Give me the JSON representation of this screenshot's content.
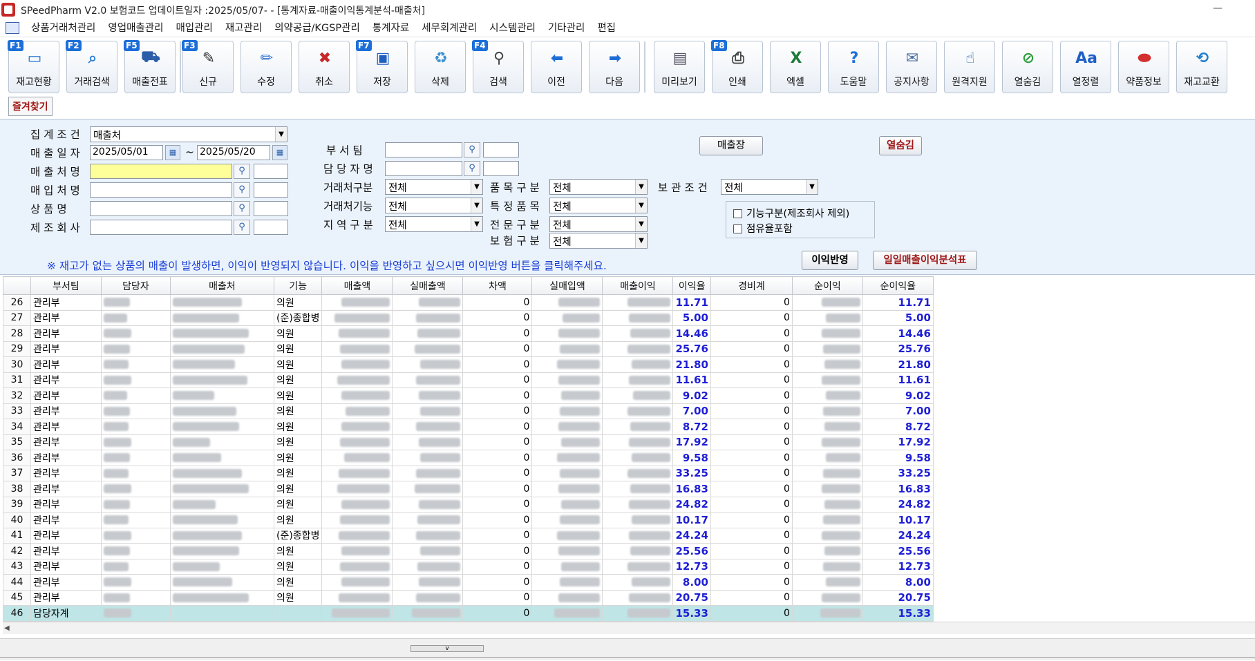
{
  "window": {
    "title": "SPeedPharm V2.0    보험코드 업데이트일자 :2025/05/07-          - [통계자료-매출이익통계분석-매출처]",
    "minimize_label": "—"
  },
  "menu": [
    "상품거래처관리",
    "영업매출관리",
    "매입관리",
    "재고관리",
    "의약공급/KGSP관리",
    "통계자료",
    "세무회계관리",
    "시스템관리",
    "기타관리",
    "편집"
  ],
  "toolbar": {
    "buttons": [
      {
        "label": "재고현황",
        "fkey": "F1",
        "icon": "monitor-icon",
        "glyph": "▭",
        "color": "#1b6fd0"
      },
      {
        "label": "거래검색",
        "fkey": "F2",
        "icon": "search-person-icon",
        "glyph": "⌕",
        "color": "#2f7fd6"
      },
      {
        "label": "매출전표",
        "fkey": "F5",
        "icon": "medicine-cart-icon",
        "glyph": "⛟",
        "color": "#2a5ea8"
      },
      {
        "label": "신규",
        "fkey": "F3",
        "icon": "new-document-icon",
        "glyph": "✎",
        "color": "#333"
      },
      {
        "label": "수정",
        "fkey": "",
        "icon": "pencil-icon",
        "glyph": "✏",
        "color": "#2f6fd0"
      },
      {
        "label": "취소",
        "fkey": "",
        "icon": "trash-cancel-icon",
        "glyph": "✖",
        "color": "#c62828"
      },
      {
        "label": "저장",
        "fkey": "F7",
        "icon": "save-icon",
        "glyph": "▣",
        "color": "#1e5fc0"
      },
      {
        "label": "삭제",
        "fkey": "",
        "icon": "recycle-icon",
        "glyph": "♻",
        "color": "#3a8fd0"
      },
      {
        "label": "검색",
        "fkey": "F4",
        "icon": "magnifier-icon",
        "glyph": "⚲",
        "color": "#444"
      },
      {
        "label": "이전",
        "fkey": "",
        "icon": "arrow-left-icon",
        "glyph": "⬅",
        "color": "#1f6fd6"
      },
      {
        "label": "다음",
        "fkey": "",
        "icon": "arrow-right-icon",
        "glyph": "➡",
        "color": "#1f6fd6"
      },
      {
        "label": "미리보기",
        "fkey": "",
        "icon": "preview-icon",
        "glyph": "▤",
        "color": "#556"
      },
      {
        "label": "인쇄",
        "fkey": "F8",
        "icon": "printer-icon",
        "glyph": "⎙",
        "color": "#444"
      },
      {
        "label": "엑셀",
        "fkey": "",
        "icon": "excel-icon",
        "glyph": "X",
        "color": "#1e7a3a"
      },
      {
        "label": "도움말",
        "fkey": "",
        "icon": "help-icon",
        "glyph": "?",
        "color": "#1e6fd8"
      },
      {
        "label": "공지사항",
        "fkey": "",
        "icon": "notice-icon",
        "glyph": "✉",
        "color": "#4a6fa5"
      },
      {
        "label": "원격지원",
        "fkey": "",
        "icon": "remote-support-icon",
        "glyph": "☝",
        "color": "#1a5fb8"
      },
      {
        "label": "열숨김",
        "fkey": "",
        "icon": "hide-column-icon",
        "glyph": "⊘",
        "color": "#2e9e3a"
      },
      {
        "label": "열정렬",
        "fkey": "",
        "icon": "font-sort-icon",
        "glyph": "Aa",
        "color": "#1f5fc8"
      },
      {
        "label": "약품정보",
        "fkey": "",
        "icon": "pill-icon",
        "glyph": "⬬",
        "color": "#d32f2f"
      },
      {
        "label": "재고교환",
        "fkey": "",
        "icon": "exchange-icon",
        "glyph": "⟲",
        "color": "#1f7fd0"
      }
    ]
  },
  "favorites_label": "즐겨찾기",
  "filters": {
    "aggregate_label": "집 계 조 건",
    "aggregate_value": "매출처",
    "sales_date_label": "매 출 일 자",
    "date_from": "2025/05/01",
    "date_tilde": "~",
    "date_to": "2025/05/20",
    "customer_label": "매 출 처 명",
    "supplier_label": "매 입 처 명",
    "product_label": "상   품   명",
    "maker_label": "제 조 회 사",
    "dept_label": "부   서   팀",
    "manager_label": "담 당 자 명",
    "client_type_label": "거래처구분",
    "client_type_value": "전체",
    "client_func_label": "거래처기능",
    "client_func_value": "전체",
    "region_label": "지 역 구 분",
    "region_value": "전체",
    "item_type_label": "품 목 구 분",
    "item_type_value": "전체",
    "special_item_label": "특 정 품 목",
    "special_item_value": "전체",
    "specialty_label": "전 문 구 분",
    "specialty_value": "전체",
    "insurance_label": "보 험 구 분",
    "insurance_value": "전체",
    "storage_label": "보 관 조 건",
    "storage_value": "전체",
    "check_function": "기능구분(제조회사 제외)",
    "check_share": "점유율포함",
    "ledger_button": "매출장",
    "hide_column_button": "열숨김",
    "profit_apply_button": "이익반영",
    "daily_analysis_button": "일일매출이익분석표",
    "notice": "※ 재고가 없는 상품의 매출이 발생하면, 이익이 반영되지 않습니다. 이익을 반영하고 싶으시면 이익반영 버튼을 클릭해주세요."
  },
  "table": {
    "columns": [
      "",
      "부서팀",
      "담당자",
      "매출처",
      "기능",
      "매출액",
      "실매출액",
      "차액",
      "실매입액",
      "매출이익",
      "이익율",
      "경비계",
      "순이익",
      "순이익율"
    ],
    "rows": [
      {
        "n": "26",
        "dept": "관리부",
        "func": "의원",
        "diff": "0",
        "rate": "11.71",
        "expense": "0",
        "net_rate": "11.71"
      },
      {
        "n": "27",
        "dept": "관리부",
        "func": "(준)종합병",
        "diff": "0",
        "rate": "5.00",
        "expense": "0",
        "net_rate": "5.00"
      },
      {
        "n": "28",
        "dept": "관리부",
        "func": "의원",
        "diff": "0",
        "rate": "14.46",
        "expense": "0",
        "net_rate": "14.46"
      },
      {
        "n": "29",
        "dept": "관리부",
        "func": "의원",
        "diff": "0",
        "rate": "25.76",
        "expense": "0",
        "net_rate": "25.76"
      },
      {
        "n": "30",
        "dept": "관리부",
        "func": "의원",
        "diff": "0",
        "rate": "21.80",
        "expense": "0",
        "net_rate": "21.80"
      },
      {
        "n": "31",
        "dept": "관리부",
        "func": "의원",
        "diff": "0",
        "rate": "11.61",
        "expense": "0",
        "net_rate": "11.61"
      },
      {
        "n": "32",
        "dept": "관리부",
        "func": "의원",
        "diff": "0",
        "rate": "9.02",
        "expense": "0",
        "net_rate": "9.02"
      },
      {
        "n": "33",
        "dept": "관리부",
        "func": "의원",
        "diff": "0",
        "rate": "7.00",
        "expense": "0",
        "net_rate": "7.00"
      },
      {
        "n": "34",
        "dept": "관리부",
        "func": "의원",
        "diff": "0",
        "rate": "8.72",
        "expense": "0",
        "net_rate": "8.72"
      },
      {
        "n": "35",
        "dept": "관리부",
        "func": "의원",
        "diff": "0",
        "rate": "17.92",
        "expense": "0",
        "net_rate": "17.92"
      },
      {
        "n": "36",
        "dept": "관리부",
        "func": "의원",
        "diff": "0",
        "rate": "9.58",
        "expense": "0",
        "net_rate": "9.58"
      },
      {
        "n": "37",
        "dept": "관리부",
        "func": "의원",
        "diff": "0",
        "rate": "33.25",
        "expense": "0",
        "net_rate": "33.25"
      },
      {
        "n": "38",
        "dept": "관리부",
        "func": "의원",
        "diff": "0",
        "rate": "16.83",
        "expense": "0",
        "net_rate": "16.83"
      },
      {
        "n": "39",
        "dept": "관리부",
        "func": "의원",
        "diff": "0",
        "rate": "24.82",
        "expense": "0",
        "net_rate": "24.82"
      },
      {
        "n": "40",
        "dept": "관리부",
        "func": "의원",
        "diff": "0",
        "rate": "10.17",
        "expense": "0",
        "net_rate": "10.17"
      },
      {
        "n": "41",
        "dept": "관리부",
        "func": "(준)종합병",
        "diff": "0",
        "rate": "24.24",
        "expense": "0",
        "net_rate": "24.24"
      },
      {
        "n": "42",
        "dept": "관리부",
        "func": "의원",
        "diff": "0",
        "rate": "25.56",
        "expense": "0",
        "net_rate": "25.56"
      },
      {
        "n": "43",
        "dept": "관리부",
        "func": "의원",
        "diff": "0",
        "rate": "12.73",
        "expense": "0",
        "net_rate": "12.73"
      },
      {
        "n": "44",
        "dept": "관리부",
        "func": "의원",
        "diff": "0",
        "rate": "8.00",
        "expense": "0",
        "net_rate": "8.00"
      },
      {
        "n": "45",
        "dept": "관리부",
        "func": "의원",
        "diff": "0",
        "rate": "20.75",
        "expense": "0",
        "net_rate": "20.75"
      },
      {
        "n": "46",
        "dept": "담당자계",
        "func": "",
        "diff": "0",
        "rate": "15.33",
        "expense": "0",
        "net_rate": "15.33",
        "total": true
      }
    ]
  },
  "scroll": {
    "left_arrow": "◀",
    "splitter_glyph": "v"
  },
  "colors": {
    "accent": "#1c6fd8",
    "panel_bg": "#eaf2fb",
    "rate_text": "#1e1ed6",
    "total_row": "#bfe5e6",
    "highlight_input": "#ffff99"
  }
}
